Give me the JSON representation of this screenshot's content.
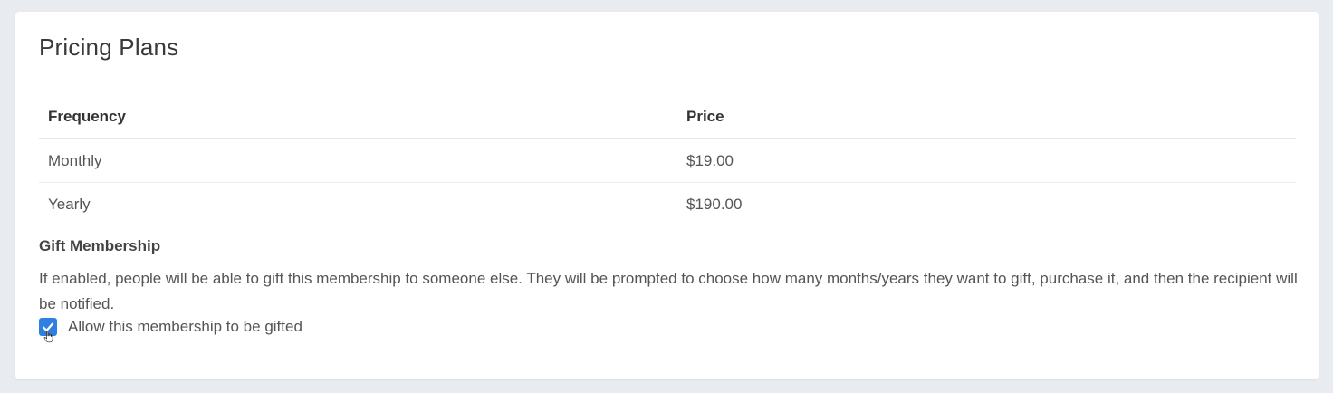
{
  "card": {
    "title": "Pricing Plans"
  },
  "pricing_table": {
    "headers": {
      "frequency": "Frequency",
      "price": "Price"
    },
    "rows": [
      {
        "frequency": "Monthly",
        "price": "$19.00"
      },
      {
        "frequency": "Yearly",
        "price": "$190.00"
      }
    ]
  },
  "gift": {
    "title": "Gift Membership",
    "description": "If enabled, people will be able to gift this membership to someone else. They will be prompted to choose how many months/years they want to gift, purchase it, and then the recipient will be notified.",
    "checkbox_label": "Allow this membership to be gifted",
    "checked": true
  },
  "colors": {
    "accent": "#2f7fe0",
    "page_bg": "#e8ebef",
    "card_bg": "#ffffff"
  },
  "icons": {
    "checkmark": "check-icon",
    "cursor": "hand-pointer-icon"
  }
}
